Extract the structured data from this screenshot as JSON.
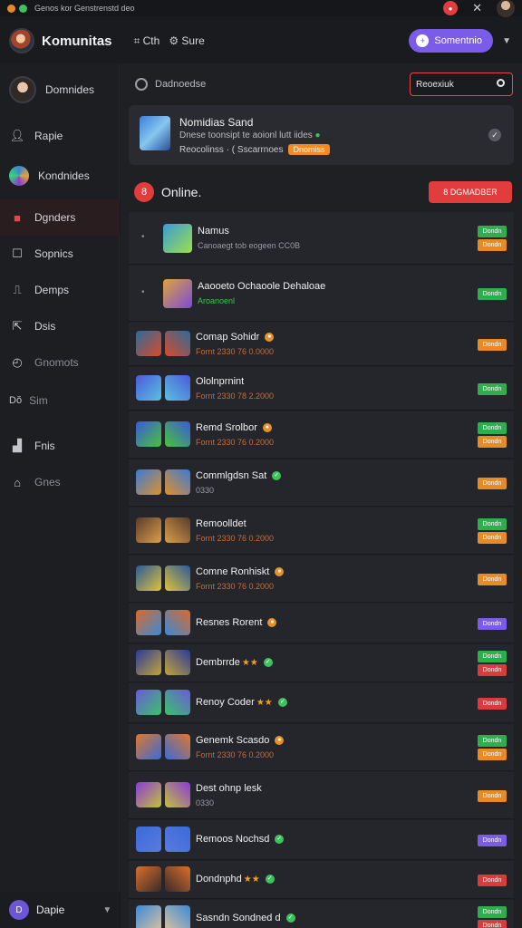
{
  "window": {
    "title": "Genos kor Genstrenstd deo",
    "close": "✕"
  },
  "header": {
    "brand": "Komunitas",
    "links": [
      {
        "icon": "grid-icon",
        "label": "Cth"
      },
      {
        "icon": "settings-icon",
        "label": "Sure"
      }
    ],
    "cta_label": "Somentnio"
  },
  "sidebar": {
    "items": [
      {
        "icon": "avatar",
        "label": "Domnides"
      },
      {
        "icon": "user-icon",
        "label": "Rapie"
      },
      {
        "icon": "community-icon",
        "label": "Kondnides"
      },
      {
        "icon": "store-icon",
        "label": "Dgnders"
      },
      {
        "icon": "square-icon",
        "label": "Sopnics"
      },
      {
        "icon": "book-icon",
        "label": "Demps"
      },
      {
        "icon": "share-icon",
        "label": "Dsis"
      },
      {
        "icon": "clock-icon",
        "label": "Gnomots"
      },
      {
        "icon": "dots-icon",
        "label": "Sim",
        "prefix": "Dŏ"
      },
      {
        "icon": "chart-icon",
        "label": "Fnis"
      },
      {
        "icon": "building-icon",
        "label": "Gnes"
      }
    ],
    "footer": {
      "initial": "D",
      "label": "Dapie"
    }
  },
  "main": {
    "top_label": "Dadnoedse",
    "search_value": "Reoexiuk",
    "featured": {
      "title": "Nomidias Sand",
      "subtitle": "Dnese toonsipt te aoionl lutt iides",
      "line3": "Reocolinss  ·  ( Sscarrnoes",
      "badge": "Dnomiss"
    },
    "online": {
      "label": "Online.",
      "button": "8 DGMADBER",
      "icon": "8"
    },
    "rows": [
      {
        "name": "Namus",
        "meta": "Canoaegt tob eogeen CC0B",
        "tags": [
          "green",
          "orange"
        ],
        "icons": 1
      },
      {
        "name": "Aaooeto Ochaoole Dehaloae",
        "meta": "Aroanoenl",
        "meta_green": true,
        "tags": [
          "green"
        ],
        "icons": 1
      },
      {
        "name": "Comap Sohidr",
        "meta": "Fornt 2330 76 0.0000",
        "status": "orange",
        "tags": [
          "orange"
        ],
        "icons": 2
      },
      {
        "name": "Ololnprnint",
        "meta": "Fornt 2330 78 2.2000",
        "tags": [
          "green"
        ],
        "icons": 2
      },
      {
        "name": "Remd Srolbor",
        "meta": "Fornt 2330 76 0.2000",
        "status": "orange",
        "tags": [
          "green",
          "orange"
        ],
        "icons": 2
      },
      {
        "name": "Commlgdsn Sat",
        "meta": "0330",
        "status": "green",
        "tags": [
          "orange"
        ],
        "icons": 2
      },
      {
        "name": "Remoolldet",
        "meta": "Fornt 2330 76 0.2000",
        "tags": [
          "green",
          "orange"
        ],
        "icons": 2
      },
      {
        "name": "Comne Ronhiskt",
        "meta": "Fornt 2330 76 0.2000",
        "status": "orange",
        "tags": [
          "orange"
        ],
        "icons": 2
      },
      {
        "name": "Resnes Rorent",
        "meta": "",
        "status": "orange",
        "tags": [
          "purple"
        ],
        "icons": 2
      },
      {
        "name": "Dembrrde",
        "meta": "",
        "stars": "★★",
        "status": "green",
        "tags": [
          "green",
          "red"
        ],
        "icons": 2
      },
      {
        "name": "Renoy Coder",
        "meta": "",
        "stars": "★★",
        "status": "green",
        "tags": [
          "red"
        ],
        "icons": 2
      },
      {
        "name": "Genemk Scasdo",
        "meta": "Fornt 2330 76 0.2000",
        "status": "orange",
        "tags": [
          "green",
          "orange"
        ],
        "icons": 2
      },
      {
        "name": "Dest ohnp lesk",
        "meta": "0330",
        "tags": [
          "orange"
        ],
        "icons": 2
      },
      {
        "name": "Remoos Nochsd",
        "meta": "",
        "status": "green",
        "tags": [
          "purple"
        ],
        "icons": 2
      },
      {
        "name": "Dondnphd",
        "meta": "",
        "stars": "★★",
        "status": "green",
        "tags": [
          "red"
        ],
        "icons": 2
      },
      {
        "name": "Sasndn Sondned d",
        "meta": "",
        "status": "green",
        "tags": [
          "green",
          "red"
        ],
        "icons": 2
      }
    ],
    "tag_text": "Dondn"
  }
}
